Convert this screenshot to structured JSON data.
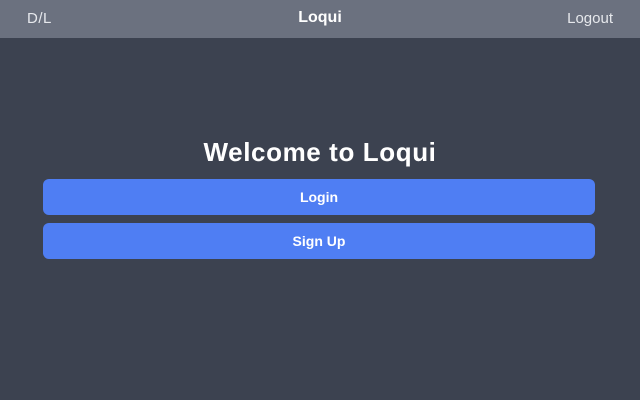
{
  "header": {
    "left_label": "D/L",
    "title": "Loqui",
    "logout_label": "Logout"
  },
  "main": {
    "welcome_text": "Welcome to Loqui",
    "login_label": "Login",
    "signup_label": "Sign Up"
  },
  "colors": {
    "header_bg": "#6b717f",
    "page_bg": "#3c4250",
    "button_bg": "#4f7ef3",
    "text": "#ffffff"
  }
}
